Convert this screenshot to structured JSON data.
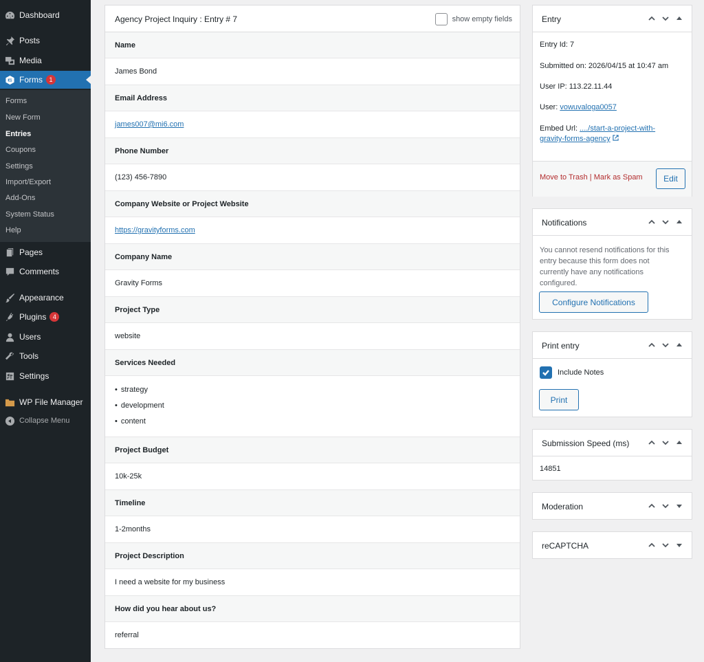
{
  "sidebar": {
    "menu": [
      {
        "label": "Dashboard",
        "icon": "dashboard-icon"
      },
      {
        "label": "Posts",
        "icon": "pin-icon"
      },
      {
        "label": "Media",
        "icon": "media-icon"
      },
      {
        "label": "Forms",
        "icon": "gravity-forms-icon",
        "badge": "1"
      },
      {
        "label": "Pages",
        "icon": "page-icon"
      },
      {
        "label": "Comments",
        "icon": "comment-icon"
      },
      {
        "label": "Appearance",
        "icon": "brush-icon"
      },
      {
        "label": "Plugins",
        "icon": "plug-icon",
        "badge": "4"
      },
      {
        "label": "Users",
        "icon": "user-icon"
      },
      {
        "label": "Tools",
        "icon": "wrench-icon"
      },
      {
        "label": "Settings",
        "icon": "settings-icon"
      },
      {
        "label": "WP File Manager",
        "icon": "folder-icon"
      },
      {
        "label": "Collapse Menu",
        "icon": "collapse-icon"
      }
    ],
    "forms_submenu": [
      "Forms",
      "New Form",
      "Entries",
      "Coupons",
      "Settings",
      "Import/Export",
      "Add-Ons",
      "System Status",
      "Help"
    ]
  },
  "entry": {
    "title": "Agency Project Inquiry : Entry # 7",
    "show_empty_label": "show empty fields",
    "fields": [
      {
        "label": "Name",
        "value": "James Bond"
      },
      {
        "label": "Email Address",
        "value": "james007@mi6.com",
        "link": true
      },
      {
        "label": "Phone Number",
        "value": "(123) 456-7890"
      },
      {
        "label": "Company Website or Project Website",
        "value": "https://gravityforms.com",
        "link": true
      },
      {
        "label": "Company Name",
        "value": "Gravity Forms"
      },
      {
        "label": "Project Type",
        "value": "website"
      },
      {
        "label": "Services Needed",
        "items": [
          "strategy",
          "development",
          "content"
        ]
      },
      {
        "label": "Project Budget",
        "value": "10k-25k"
      },
      {
        "label": "Timeline",
        "value": "1-2months"
      },
      {
        "label": "Project Description",
        "value": "I need a website for my business"
      },
      {
        "label": "How did you hear about us?",
        "value": "referral"
      }
    ]
  },
  "entry_box": {
    "title": "Entry",
    "entry_id": "Entry Id: 7",
    "submitted": "Submitted on: 2026/04/15 at 10:47 am",
    "user_ip": "User IP: 113.22.11.44",
    "user_label": "User: ",
    "user_name": "vowuvaloga0057",
    "embed_label": "Embed Url: ",
    "embed_url_1": "..../start-a-project-with-",
    "embed_url_2": "gravity-forms-agency",
    "trash": "Move to Trash",
    "separator": " | ",
    "spam": "Mark as Spam",
    "edit": "Edit"
  },
  "notifications_box": {
    "title": "Notifications",
    "message_lines": [
      "You cannot resend notifications for this",
      "entry because this form does not",
      "currently have any notifications",
      "configured."
    ],
    "button": "Configure Notifications"
  },
  "print_box": {
    "title": "Print entry",
    "include_notes": "Include Notes",
    "include_notes_checked": true,
    "button": "Print"
  },
  "speed_box": {
    "title": "Submission Speed (ms)",
    "value": "14851"
  },
  "moderation_box": {
    "title": "Moderation"
  },
  "recaptcha_box": {
    "title": "reCAPTCHA"
  }
}
